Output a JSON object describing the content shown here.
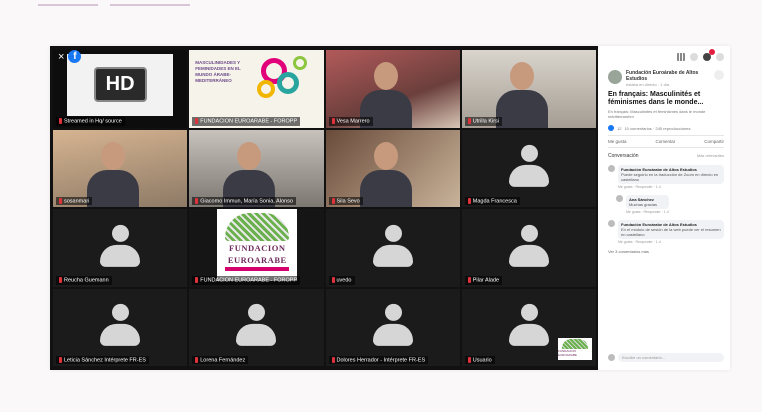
{
  "meeting": {
    "participants": [
      {
        "name": "Streamed in Hq/ source",
        "type": "hd"
      },
      {
        "name": "FUNDACION EUROARABE - FOROPP",
        "type": "poster"
      },
      {
        "name": "Vesa Marrero",
        "type": "cam",
        "variant": "c3"
      },
      {
        "name": "Utrilla Kirsi",
        "type": "cam",
        "variant": "c2"
      },
      {
        "name": "sosanmari",
        "type": "cam",
        "variant": "c4"
      },
      {
        "name": "Giacomo Immun, María Sonia, Alonso",
        "type": "cam",
        "variant": "c5"
      },
      {
        "name": "Sila Sevo",
        "type": "cam",
        "variant": "c1"
      },
      {
        "name": "Magda Francesca",
        "type": "avatar"
      },
      {
        "name": "Reucha Guemann",
        "type": "avatar"
      },
      {
        "name": "FUNDACION EUROARABE - FOROPP",
        "type": "logo"
      },
      {
        "name": "uvedo",
        "type": "avatar"
      },
      {
        "name": "Pilar Alade",
        "type": "avatar"
      },
      {
        "name": "Leticia Sánchez Intérprete FR-ES",
        "type": "avatar"
      },
      {
        "name": "Lorena Fernández",
        "type": "avatar"
      },
      {
        "name": "Dolores Herrador - Intérprete FR-ES",
        "type": "avatar"
      },
      {
        "name": "Usuario",
        "type": "avatar",
        "mini_logo": true
      }
    ],
    "close_glyph": "×",
    "fb_glyph": "f",
    "hd_text": "HD",
    "poster_text": "MASCULINIDADES Y FEMINIDADES EN EL MUNDO ÁRABE-MEDITERRÁNEO",
    "logo_line1": "FUNDACION",
    "logo_line2": "EUROARABE",
    "mini_logo_text": "FUNDACION EUROARABE"
  },
  "sidebar": {
    "page_name": "Fundación Euroárabe de Altos Estudios",
    "page_meta": "estaba en directo · 1 día",
    "post_title": "En français: Masculinités et féminismes dans le monde...",
    "post_sub": "En français: Masculinités et féminismes dans le monde méditerranéen",
    "reactions": "12",
    "shares": "10 comentarios · 245 reproducciones",
    "actions": [
      "Me gusta",
      "Comentar",
      "Compartir"
    ],
    "conversation_label": "Conversación",
    "sort_label": "Más relevantes",
    "comments": [
      {
        "author": "Fundación Euroárabe de Altos Estudios",
        "text": "Puede seguirlo en la traducción de Zoom en directo en castellano",
        "actions": "Me gusta · Responder · 1 d"
      },
      {
        "author": "Ana Sánchez",
        "text": "Muchas gracias",
        "actions": "Me gusta · Responder · 1 d"
      },
      {
        "author": "Fundación Euroárabe de Altos Estudios",
        "text": "En el módulo de sesión de la web puede ver el resumen en castellano",
        "actions": "Me gusta · Responder · 1 d"
      }
    ],
    "more_comments": "Ver 3 comentarios más",
    "comment_placeholder": "Escribe un comentario..."
  }
}
